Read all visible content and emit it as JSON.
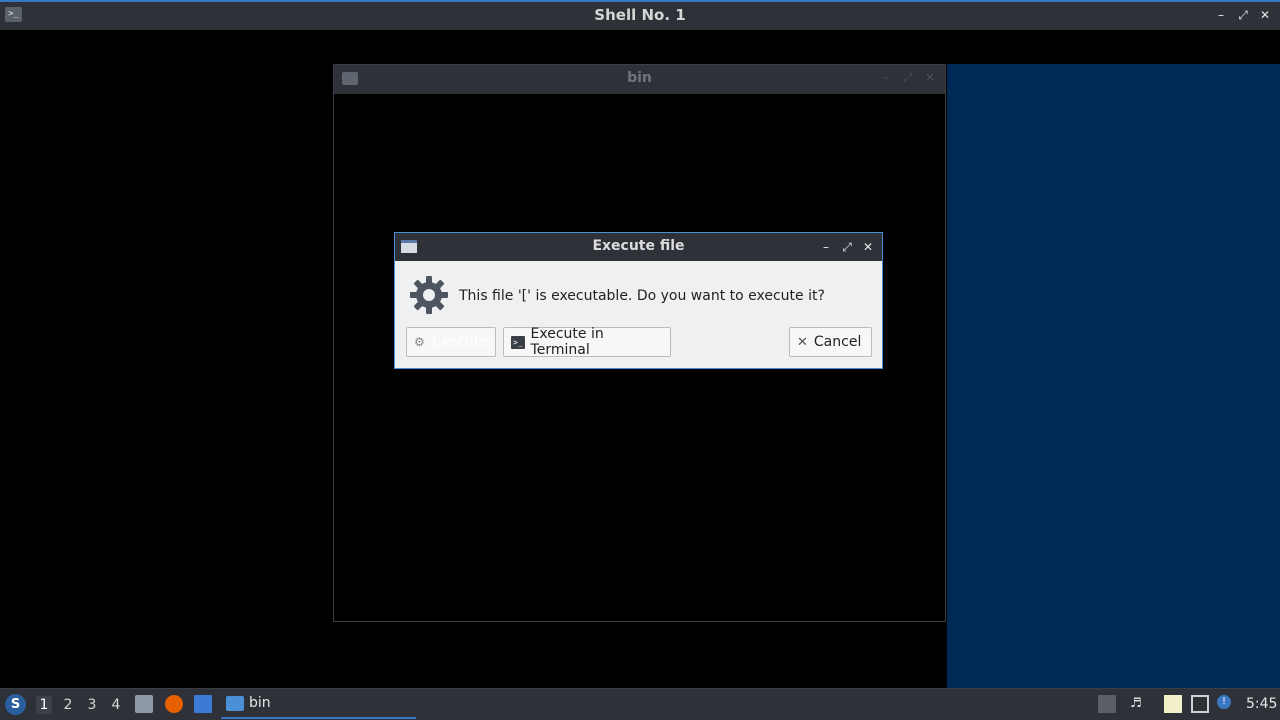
{
  "shell": {
    "title": "Shell No. 1",
    "app_icon": ">_"
  },
  "bin_window": {
    "title": "bin"
  },
  "dialog": {
    "title": "Execute file",
    "message": "This file '[' is executable. Do you want to execute it?",
    "buttons": {
      "execute": "Execute",
      "execute_terminal": "Execute in Terminal",
      "cancel": "Cancel"
    }
  },
  "taskbar": {
    "workspaces": [
      "1",
      "2",
      "3",
      "4"
    ],
    "active_workspace": "1",
    "task_label": "bin",
    "clock": "5:45"
  },
  "colors": {
    "accent": "#3a77c3",
    "titlebar": "#2e3238",
    "desktop_blue": "#002a55"
  }
}
